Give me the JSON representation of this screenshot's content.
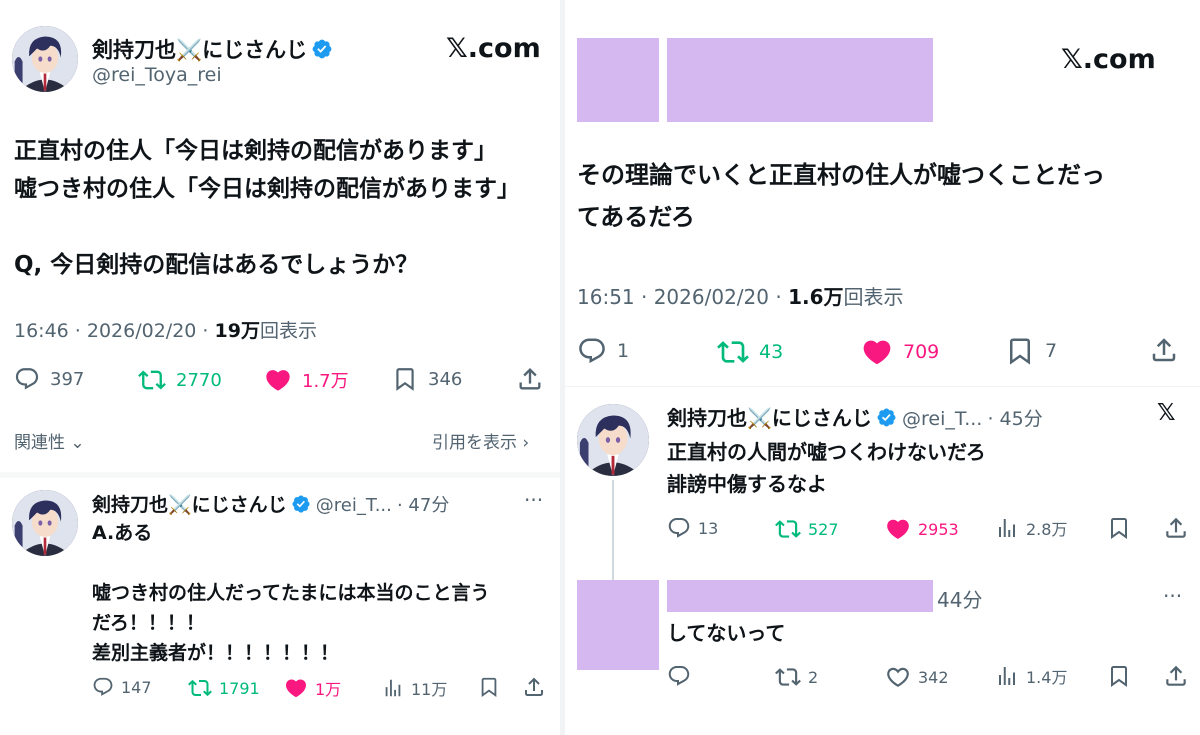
{
  "left": {
    "main_tweet": {
      "author_name": "剣持刀也⚔️にじさんじ",
      "handle": "@rei_Toya_rei",
      "site": "𝕏.com",
      "text_lines": [
        "正直村の住人「今日は剣持の配信があります」",
        "嘘つき村の住人「今日は剣持の配信があります」",
        "",
        "Q, 今日剣持の配信はあるでしょうか？"
      ],
      "time": "16:46 · 2026/02/20 · ",
      "views": "19万",
      "views_label": "回表示",
      "reply_count": "397",
      "retweet_count": "2770",
      "like_count": "1.7万",
      "bookmark_count": "346",
      "related": "関連性",
      "quotes": "引用を表示"
    },
    "reply": {
      "author_name": "剣持刀也⚔️にじさんじ",
      "handle": "@rei_T...",
      "ago": "· 47分",
      "more": "···",
      "text_lines": [
        "A.ある",
        "",
        "嘘つき村の住人だってたまには本当のこと言う",
        "だろ！！！！",
        "差別主義者が！！！！！！！"
      ],
      "reply_count": "147",
      "retweet_count": "1791",
      "like_count": "1万",
      "views": "11万"
    }
  },
  "right": {
    "site": "𝕏.com",
    "main_tweet": {
      "text_lines": [
        "その理論でいくと正直村の住人が嘘つくことだっ",
        "てあるだろ"
      ],
      "time": "16:51 · 2026/02/20 · ",
      "views": "1.6万",
      "views_label": "回表示",
      "reply_count": "1",
      "retweet_count": "43",
      "like_count": "709",
      "bookmark_count": "7"
    },
    "reply1": {
      "author_name": "剣持刀也⚔️にじさんじ",
      "handle": "@rei_T...",
      "ago": "· 45分",
      "text_lines": [
        "正直村の人間が嘘つくわけないだろ",
        "誹謗中傷するなよ"
      ],
      "reply_count": "13",
      "retweet_count": "527",
      "like_count": "2953",
      "views": "2.8万"
    },
    "reply2": {
      "ago": "44分",
      "more": "···",
      "text": "してないって",
      "retweet_count": "2",
      "like_count": "342",
      "views": "1.4万"
    }
  },
  "colors": {
    "verified": "#1d9bf0",
    "retweet": "#00ba7c",
    "like": "#f91880",
    "redaction": "#d4b8ef",
    "muted": "#536471"
  }
}
